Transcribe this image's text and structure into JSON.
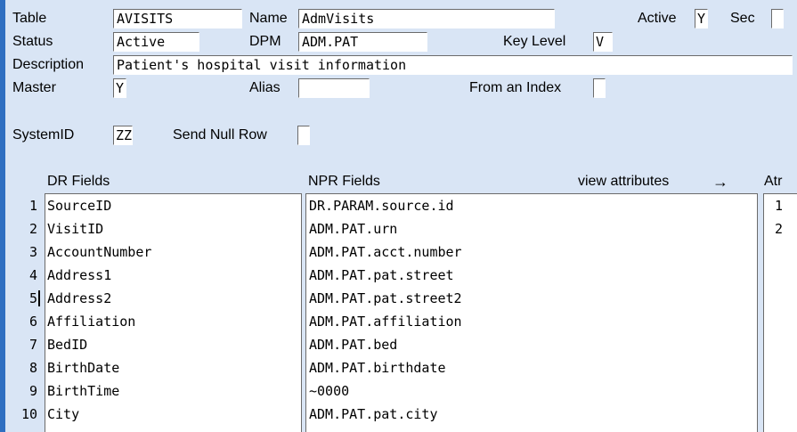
{
  "form": {
    "table_label": "Table",
    "table_value": "AVISITS",
    "name_label": "Name",
    "name_value": "AdmVisits",
    "active_label": "Active",
    "active_value": "Y",
    "sec_label": "Sec",
    "sec_value": "",
    "status_label": "Status",
    "status_value": "Active",
    "dpm_label": "DPM",
    "dpm_value": "ADM.PAT",
    "keylevel_label": "Key Level",
    "keylevel_value": "V",
    "description_label": "Description",
    "description_value": "Patient's hospital visit information",
    "master_label": "Master",
    "master_value": "Y",
    "alias_label": "Alias",
    "alias_value": "",
    "fromindex_label": "From an Index",
    "fromindex_value": "",
    "systemid_label": "SystemID",
    "systemid_value": "ZZ",
    "sendnull_label": "Send Null Row",
    "sendnull_value": ""
  },
  "grid": {
    "dr_header": "DR Fields",
    "npr_header": "NPR Fields",
    "view_attributes": "view attributes",
    "arrow": "→",
    "atr_header": "Atr",
    "rows": [
      {
        "num": "1",
        "dr": "SourceID",
        "npr": "DR.PARAM.source.id",
        "atr": "1"
      },
      {
        "num": "2",
        "dr": "VisitID",
        "npr": "ADM.PAT.urn",
        "atr": "2"
      },
      {
        "num": "3",
        "dr": "AccountNumber",
        "npr": "ADM.PAT.acct.number",
        "atr": ""
      },
      {
        "num": "4",
        "dr": "Address1",
        "npr": "ADM.PAT.pat.street",
        "atr": ""
      },
      {
        "num": "5",
        "dr": "Address2",
        "npr": "ADM.PAT.pat.street2",
        "atr": ""
      },
      {
        "num": "6",
        "dr": "Affiliation",
        "npr": "ADM.PAT.affiliation",
        "atr": ""
      },
      {
        "num": "7",
        "dr": "BedID",
        "npr": "ADM.PAT.bed",
        "atr": ""
      },
      {
        "num": "8",
        "dr": "BirthDate",
        "npr": "ADM.PAT.birthdate",
        "atr": ""
      },
      {
        "num": "9",
        "dr": "BirthTime",
        "npr": "~0000",
        "atr": ""
      },
      {
        "num": "10",
        "dr": "City",
        "npr": "ADM.PAT.pat.city",
        "atr": ""
      }
    ]
  }
}
